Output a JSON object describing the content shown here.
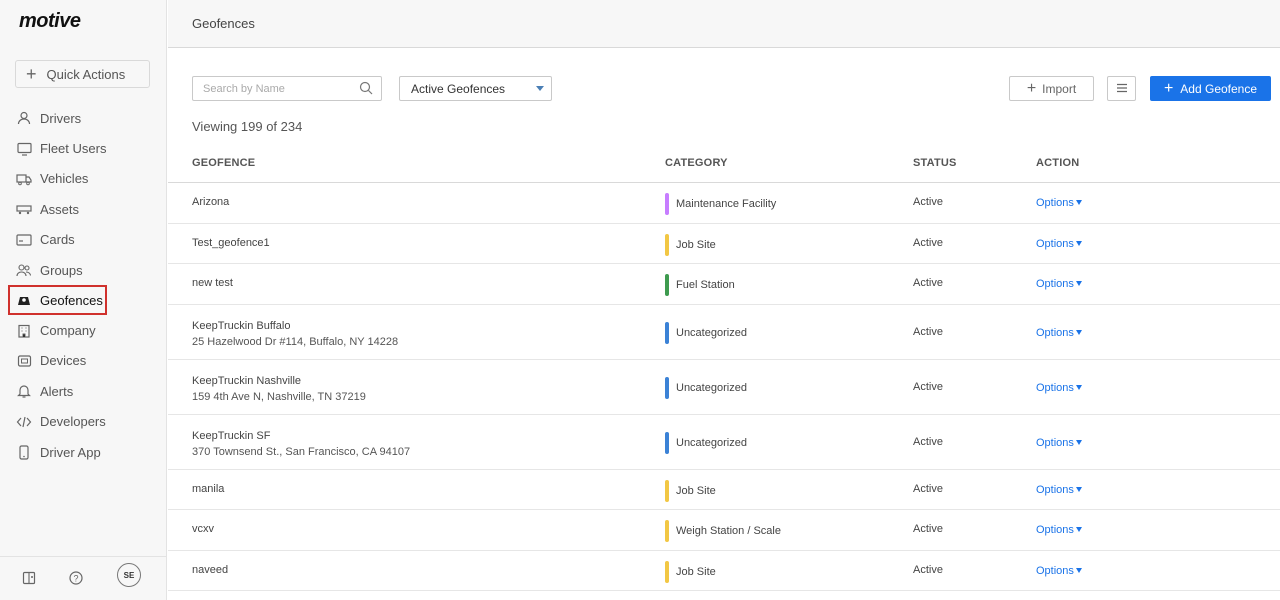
{
  "brand": {
    "name": "motive"
  },
  "sidebar": {
    "quick_actions_label": "Quick Actions",
    "items": [
      {
        "label": "Drivers",
        "icon": "user-icon"
      },
      {
        "label": "Fleet Users",
        "icon": "monitor-icon"
      },
      {
        "label": "Vehicles",
        "icon": "truck-icon"
      },
      {
        "label": "Assets",
        "icon": "trailer-icon"
      },
      {
        "label": "Cards",
        "icon": "card-icon"
      },
      {
        "label": "Groups",
        "icon": "users-icon"
      },
      {
        "label": "Geofences",
        "icon": "geofence-icon",
        "active": true
      },
      {
        "label": "Company",
        "icon": "building-icon"
      },
      {
        "label": "Devices",
        "icon": "device-icon"
      },
      {
        "label": "Alerts",
        "icon": "bell-icon"
      },
      {
        "label": "Developers",
        "icon": "code-icon"
      },
      {
        "label": "Driver App",
        "icon": "phone-icon"
      }
    ],
    "footer": {
      "avatar_initials": "SE",
      "help_icon": "help-icon",
      "book_icon": "book-icon"
    }
  },
  "header": {
    "title": "Geofences"
  },
  "toolbar": {
    "search_placeholder": "Search by Name",
    "filter_value": "Active Geofences",
    "import_label": "Import",
    "add_label": "Add Geofence"
  },
  "viewing_text": "Viewing 199 of 234",
  "table": {
    "columns": [
      "GEOFENCE",
      "CATEGORY",
      "STATUS",
      "ACTION"
    ],
    "rows": [
      {
        "name": "Arizona",
        "address": "",
        "category": "Maintenance Facility",
        "cat_color": "#c77dff",
        "status": "Active",
        "action": "Options"
      },
      {
        "name": "Test_geofence1",
        "address": "",
        "category": "Job Site",
        "cat_color": "#f2c744",
        "status": "Active",
        "action": "Options"
      },
      {
        "name": "new test",
        "address": "",
        "category": "Fuel Station",
        "cat_color": "#3e9b4f",
        "status": "Active",
        "action": "Options"
      },
      {
        "name": "KeepTruckin Buffalo",
        "address": "25 Hazelwood Dr #114, Buffalo, NY 14228",
        "category": "Uncategorized",
        "cat_color": "#3b82d6",
        "status": "Active",
        "action": "Options"
      },
      {
        "name": "KeepTruckin Nashville",
        "address": "159 4th Ave N, Nashville, TN 37219",
        "category": "Uncategorized",
        "cat_color": "#3b82d6",
        "status": "Active",
        "action": "Options"
      },
      {
        "name": "KeepTruckin SF",
        "address": "370 Townsend St., San Francisco, CA 94107",
        "category": "Uncategorized",
        "cat_color": "#3b82d6",
        "status": "Active",
        "action": "Options"
      },
      {
        "name": "manila",
        "address": "",
        "category": "Job Site",
        "cat_color": "#f2c744",
        "status": "Active",
        "action": "Options"
      },
      {
        "name": "vcxv",
        "address": "",
        "category": "Weigh Station / Scale",
        "cat_color": "#f2c744",
        "status": "Active",
        "action": "Options"
      },
      {
        "name": "naveed",
        "address": "",
        "category": "Job Site",
        "cat_color": "#f2c744",
        "status": "Active",
        "action": "Options"
      }
    ]
  }
}
